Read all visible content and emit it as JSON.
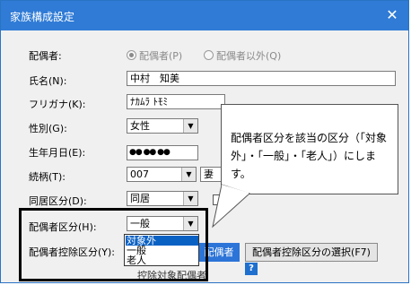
{
  "window": {
    "title": "家族構成設定",
    "close_icon": "close-icon"
  },
  "form": {
    "spouse_label": "配偶者:",
    "radio_spouse": "配偶者(P)",
    "radio_other": "配偶者以外(Q)",
    "name_label": "氏名(N):",
    "name_value": "中村　知美",
    "kana_label": "フリガナ(K):",
    "kana_value": "ﾅｶﾑﾗ ﾄﾓﾐ",
    "gender_label": "性別(G):",
    "gender_value": "女性",
    "birth_label": "生年月日(E):",
    "birth_value": "●● ●● ●●",
    "relation_label": "続柄(T):",
    "relation_code": "007",
    "relation_value": "妻",
    "cohabit_label": "同居区分(D):",
    "cohabit_value": "同居",
    "category_label": "配偶者区分(H):",
    "category_value": "一般",
    "category_options": [
      "対象外",
      "一般",
      "老人"
    ],
    "deduction_label": "配偶者控除区分(Y):",
    "deduction_partial": "配偶者",
    "deduction_button": "配偶者控除区分の選択(F7)",
    "deduction_under": "控除対象配偶者",
    "help_label": "?"
  },
  "callout": {
    "text": "配偶者区分を該当の区分（「対象外」・「一般」・「老人」）にします。"
  }
}
